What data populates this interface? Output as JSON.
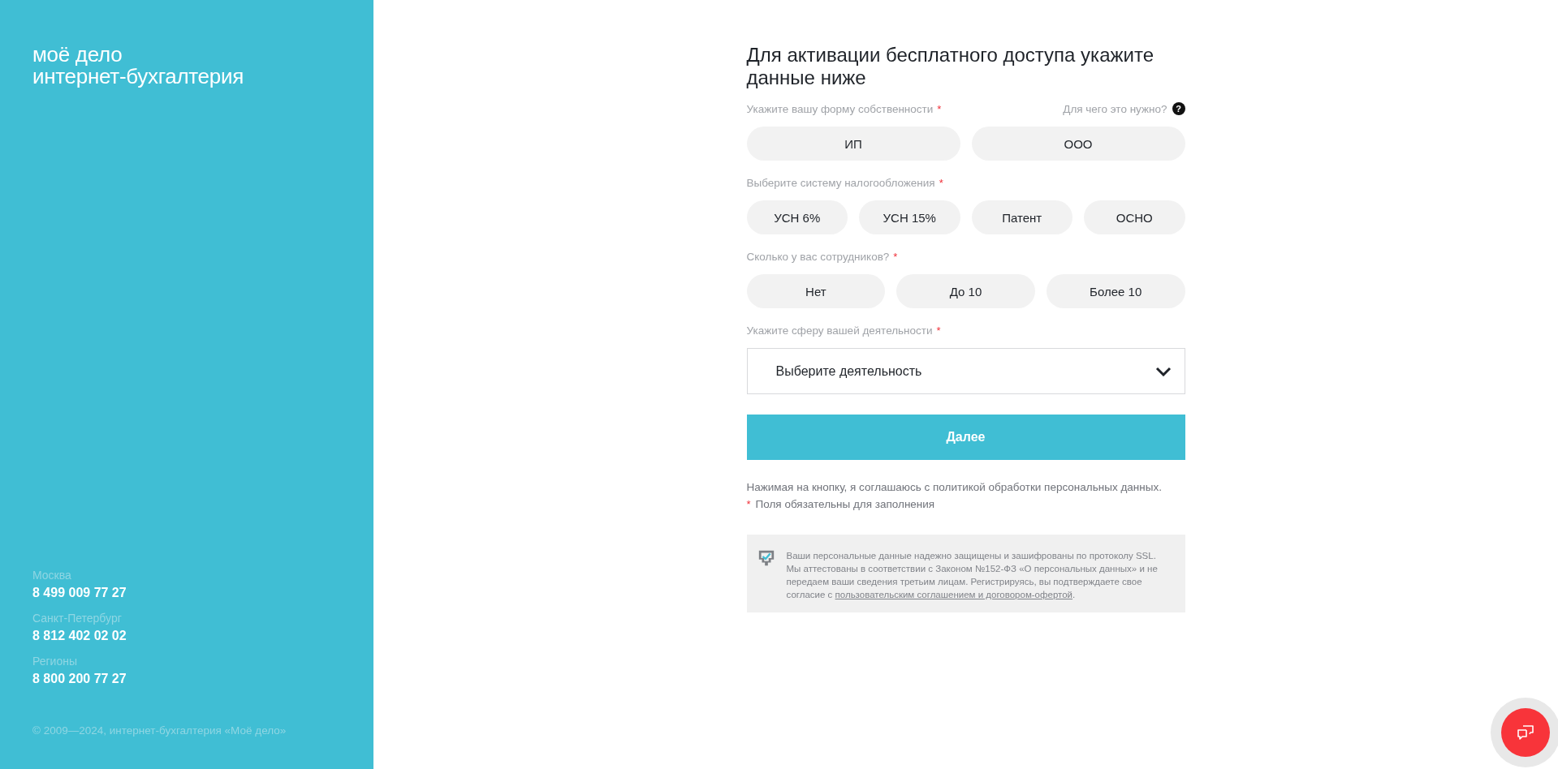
{
  "sidebar": {
    "logo": {
      "line_1": "моё дело",
      "line_2": "интернет-бухгалтерия"
    },
    "contacts": [
      {
        "city": "Москва",
        "phone": "8 499 009 77 27"
      },
      {
        "city": "Санкт-Петербург",
        "phone": "8 812 402 02 02"
      },
      {
        "city": "Регионы",
        "phone": "8 800 200 77 27"
      }
    ],
    "copyright": "© 2009—2024, интернет-бухгалтерия «Моё дело»"
  },
  "form": {
    "title": "Для активации бесплатного доступа укажите данные ниже",
    "required_mark": "*",
    "questions": [
      {
        "kind": "choice",
        "label": "Укажите вашу форму собственности",
        "required": true,
        "help": "Для чего это нужно?",
        "help_icon": "?",
        "options": [
          {
            "label": "ИП",
            "selected": false
          },
          {
            "label": "ООО",
            "selected": false
          }
        ]
      },
      {
        "kind": "choice",
        "label": "Выберите систему налогообложения",
        "required": true,
        "options": [
          {
            "label": "УСН 6%",
            "selected": false
          },
          {
            "label": "УСН 15%",
            "selected": false
          },
          {
            "label": "Патент",
            "selected": false
          },
          {
            "label": "ОСНО",
            "selected": false
          }
        ]
      },
      {
        "kind": "choice",
        "label": "Сколько у вас сотрудников?",
        "required": true,
        "options": [
          {
            "label": "Нет",
            "selected": false
          },
          {
            "label": "До 10",
            "selected": false
          },
          {
            "label": "Более 10",
            "selected": false
          }
        ]
      },
      {
        "kind": "dropdown",
        "label": "Укажите сферу вашей деятельности",
        "required": true,
        "placeholder": "Выберите деятельность"
      }
    ],
    "submit": "Далее",
    "consent": "Нажимая на кнопку, я соглашаюсь с политикой обработки персональных данных.",
    "required_note": "Поля обязательны для заполнения",
    "security_notice": {
      "text": "Ваши персональные данные надежно защищены и зашифрованы по протоколу SSL. Мы аттестованы в соответствии с Законом №152-ФЗ «О персональных данных» и не передаем ваши сведения третьим лицам. Регистрируясь, вы подтверждаете свое согласие с",
      "link": "пользовательским соглашением и договором-офертой",
      "after": "."
    }
  }
}
